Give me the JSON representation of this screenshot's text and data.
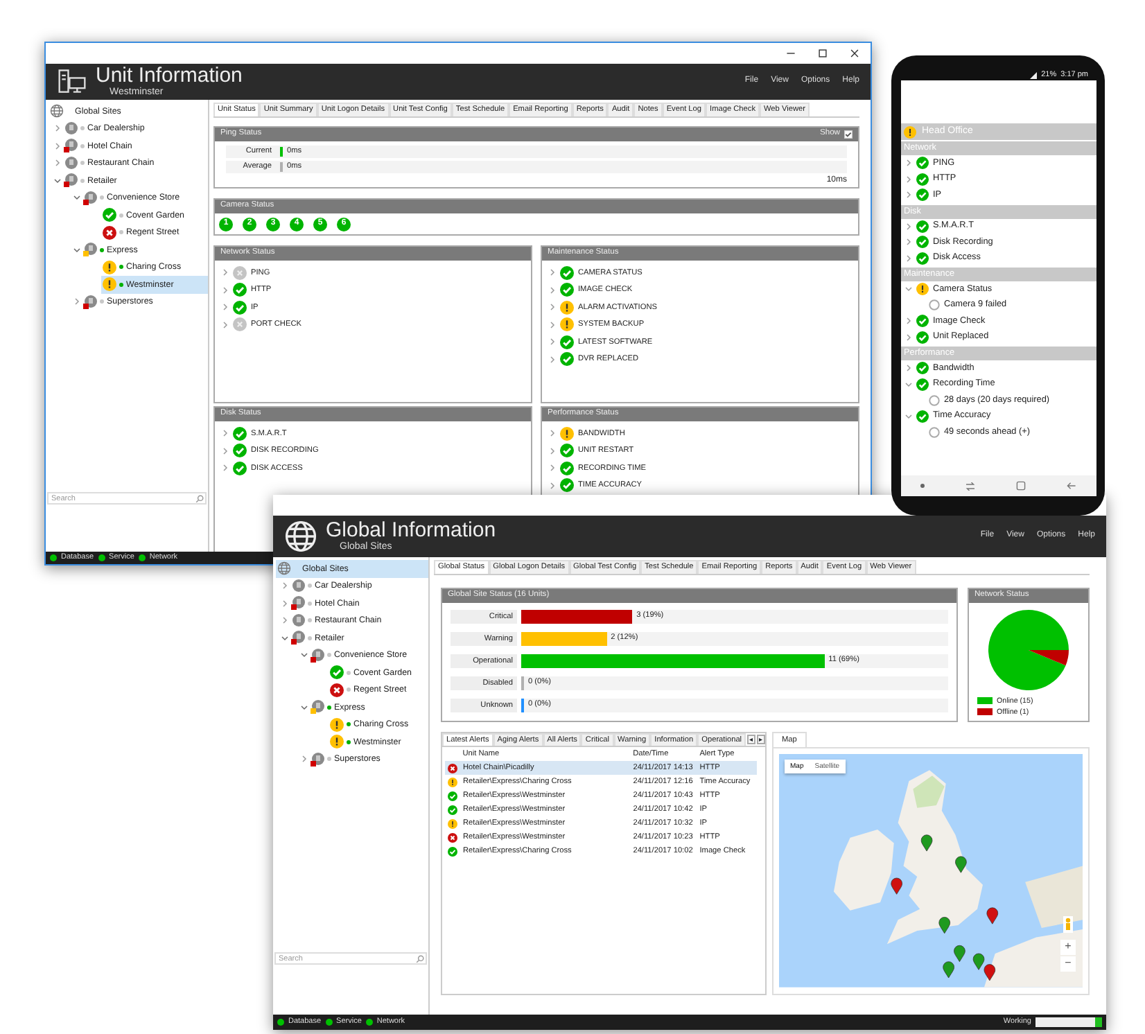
{
  "unit_window": {
    "title": "Unit Information",
    "subtitle": "Westminster",
    "menu": [
      "File",
      "View",
      "Options",
      "Help"
    ],
    "tree": {
      "root": {
        "label": "Global Sites",
        "selected": false
      },
      "items": [
        {
          "label": "Car Dealership",
          "kind": "group",
          "color": "#c8c8c8",
          "expanded": false,
          "selected": false
        },
        {
          "label": "Hotel Chain",
          "kind": "group",
          "flag": {
            "color": "#d00000"
          },
          "color": "#c8c8c8",
          "expanded": false,
          "selected": false
        },
        {
          "label": "Restaurant Chain",
          "kind": "group",
          "color": "#c8c8c8",
          "expanded": false,
          "selected": false
        },
        {
          "label": "Retailer",
          "kind": "group",
          "flag": {
            "color": "#d00000"
          },
          "color": "#c8c8c8",
          "expanded": true,
          "selected": false,
          "children": [
            {
              "label": "Convenience Store",
              "kind": "group",
              "flag": {
                "color": "#d00000"
              },
              "color": "#c8c8c8",
              "expanded": true,
              "selected": false,
              "children": [
                {
                  "label": "Covent Garden",
                  "kind": "ok",
                  "color": "#c8c8c8",
                  "selected": false
                },
                {
                  "label": "Regent Street",
                  "kind": "critical",
                  "color": "#c8c8c8",
                  "selected": false
                }
              ]
            },
            {
              "label": "Express",
              "kind": "group",
              "flag": {
                "color": "#ffc000"
              },
              "color": "#00b000",
              "expanded": true,
              "selected": false,
              "children": [
                {
                  "label": "Charing Cross",
                  "kind": "warning",
                  "color": "#00b000",
                  "selected": false
                },
                {
                  "label": "Westminster",
                  "kind": "warning",
                  "color": "#00b000",
                  "selected": true
                }
              ]
            },
            {
              "label": "Superstores",
              "kind": "group",
              "flag": {
                "color": "#d00000"
              },
              "color": "#c8c8c8",
              "expanded": false,
              "selected": false
            }
          ]
        }
      ]
    },
    "search": {
      "placeholder": "Search"
    },
    "tabs": [
      {
        "label": "Unit Status",
        "selected": true
      },
      {
        "label": "Unit Summary",
        "selected": false
      },
      {
        "label": "Unit Logon Details",
        "selected": false
      },
      {
        "label": "Unit Test Config",
        "selected": false
      },
      {
        "label": "Test Schedule",
        "selected": false
      },
      {
        "label": "Email Reporting",
        "selected": false
      },
      {
        "label": "Reports",
        "selected": false
      },
      {
        "label": "Audit",
        "selected": false
      },
      {
        "label": "Notes",
        "selected": false
      },
      {
        "label": "Event Log",
        "selected": false
      },
      {
        "label": "Image Check",
        "selected": false
      },
      {
        "label": "Web Viewer",
        "selected": false
      }
    ],
    "ping": {
      "title": "Ping Status",
      "show_label": "Show",
      "show_checked": true,
      "rows": [
        {
          "label": "Current",
          "value": "0ms",
          "level": 0.005,
          "color": "#00c000"
        },
        {
          "label": "Average",
          "value": "0ms",
          "level": 0.005,
          "color": "#b0b0b0"
        }
      ],
      "scale_max": "10ms"
    },
    "camera": {
      "title": "Camera Status",
      "cameras": [
        {
          "label": "1",
          "kind": "ok"
        },
        {
          "label": "2",
          "kind": "ok"
        },
        {
          "label": "3",
          "kind": "ok"
        },
        {
          "label": "4",
          "kind": "ok"
        },
        {
          "label": "5",
          "kind": "ok"
        },
        {
          "label": "6",
          "kind": "ok"
        }
      ]
    },
    "panels": [
      {
        "title": "Network Status",
        "items": [
          {
            "label": "PING",
            "kind": "disabled"
          },
          {
            "label": "HTTP",
            "kind": "ok"
          },
          {
            "label": "IP",
            "kind": "ok"
          },
          {
            "label": "PORT CHECK",
            "kind": "disabled"
          }
        ]
      },
      {
        "title": "Maintenance Status",
        "items": [
          {
            "label": "CAMERA STATUS",
            "kind": "ok"
          },
          {
            "label": "IMAGE CHECK",
            "kind": "ok"
          },
          {
            "label": "ALARM ACTIVATIONS",
            "kind": "warning"
          },
          {
            "label": "SYSTEM BACKUP",
            "kind": "warning"
          },
          {
            "label": "LATEST SOFTWARE",
            "kind": "ok"
          },
          {
            "label": "DVR REPLACED",
            "kind": "ok"
          }
        ]
      },
      {
        "title": "Disk Status",
        "items": [
          {
            "label": "S.M.A.R.T",
            "kind": "ok"
          },
          {
            "label": "DISK RECORDING",
            "kind": "ok"
          },
          {
            "label": "DISK ACCESS",
            "kind": "ok"
          }
        ]
      },
      {
        "title": "Performance Status",
        "items": [
          {
            "label": "BANDWIDTH",
            "kind": "warning"
          },
          {
            "label": "UNIT RESTART",
            "kind": "ok"
          },
          {
            "label": "RECORDING TIME",
            "kind": "ok"
          },
          {
            "label": "TIME ACCURACY",
            "kind": "ok"
          }
        ]
      }
    ],
    "status_bar": [
      {
        "label": "Database",
        "color": "#00c000"
      },
      {
        "label": "Service",
        "color": "#00c000"
      },
      {
        "label": "Network",
        "color": "#00c000"
      }
    ]
  },
  "phone": {
    "battery": "21%",
    "time": "3:17 pm",
    "site": {
      "label": "Head Office",
      "kind": "warning"
    },
    "sections": [
      {
        "title": "Network",
        "items": [
          {
            "label": "PING",
            "kind": "ok",
            "expanded": false
          },
          {
            "label": "HTTP",
            "kind": "ok",
            "expanded": false
          },
          {
            "label": "IP",
            "kind": "ok",
            "expanded": false
          }
        ]
      },
      {
        "title": "Disk",
        "items": [
          {
            "label": "S.M.A.R.T",
            "kind": "ok",
            "expanded": false
          },
          {
            "label": "Disk Recording",
            "kind": "ok",
            "expanded": false
          },
          {
            "label": "Disk Access",
            "kind": "ok",
            "expanded": false
          }
        ]
      },
      {
        "title": "Maintenance",
        "items": [
          {
            "label": "Camera Status",
            "kind": "warning",
            "expanded": true,
            "children": [
              {
                "label": "Camera 9 failed",
                "kind": "info"
              }
            ]
          },
          {
            "label": "Image Check",
            "kind": "ok",
            "expanded": false
          },
          {
            "label": "Unit Replaced",
            "kind": "ok",
            "expanded": false
          }
        ]
      },
      {
        "title": "Performance",
        "items": [
          {
            "label": "Bandwidth",
            "kind": "ok",
            "expanded": false
          },
          {
            "label": "Recording Time",
            "kind": "ok",
            "expanded": true,
            "children": [
              {
                "label": "28 days (20 days required)",
                "kind": "info"
              }
            ]
          },
          {
            "label": "Time Accuracy",
            "kind": "ok",
            "expanded": true,
            "children": [
              {
                "label": "49 seconds ahead (+)",
                "kind": "info"
              }
            ]
          }
        ]
      }
    ]
  },
  "global_window": {
    "title": "Global Information",
    "subtitle": "Global Sites",
    "menu": [
      "File",
      "View",
      "Options",
      "Help"
    ],
    "tree": {
      "root": {
        "label": "Global Sites",
        "selected": true
      },
      "items": [
        {
          "label": "Car Dealership",
          "kind": "group",
          "color": "#c8c8c8",
          "expanded": false,
          "selected": false
        },
        {
          "label": "Hotel Chain",
          "kind": "group",
          "flag": {
            "color": "#d00000"
          },
          "color": "#c8c8c8",
          "expanded": false,
          "selected": false
        },
        {
          "label": "Restaurant Chain",
          "kind": "group",
          "color": "#c8c8c8",
          "expanded": false,
          "selected": false
        },
        {
          "label": "Retailer",
          "kind": "group",
          "flag": {
            "color": "#d00000"
          },
          "color": "#c8c8c8",
          "expanded": true,
          "selected": false,
          "children": [
            {
              "label": "Convenience Store",
              "kind": "group",
              "flag": {
                "color": "#d00000"
              },
              "color": "#c8c8c8",
              "expanded": true,
              "selected": false,
              "children": [
                {
                  "label": "Covent Garden",
                  "kind": "ok",
                  "color": "#c8c8c8",
                  "selected": false
                },
                {
                  "label": "Regent Street",
                  "kind": "critical",
                  "color": "#c8c8c8",
                  "selected": false
                }
              ]
            },
            {
              "label": "Express",
              "kind": "group",
              "flag": {
                "color": "#ffc000"
              },
              "color": "#00b000",
              "expanded": true,
              "selected": false,
              "children": [
                {
                  "label": "Charing Cross",
                  "kind": "warning",
                  "color": "#00b000",
                  "selected": false
                },
                {
                  "label": "Westminster",
                  "kind": "warning",
                  "color": "#00b000",
                  "selected": false
                }
              ]
            },
            {
              "label": "Superstores",
              "kind": "group",
              "flag": {
                "color": "#d00000"
              },
              "color": "#c8c8c8",
              "expanded": false,
              "selected": false
            }
          ]
        }
      ]
    },
    "search": {
      "placeholder": "Search"
    },
    "tabs": [
      {
        "label": "Global Status",
        "selected": true
      },
      {
        "label": "Global Logon Details",
        "selected": false
      },
      {
        "label": "Global Test Config",
        "selected": false
      },
      {
        "label": "Test Schedule",
        "selected": false
      },
      {
        "label": "Email Reporting",
        "selected": false
      },
      {
        "label": "Reports",
        "selected": false
      },
      {
        "label": "Audit",
        "selected": false
      },
      {
        "label": "Event Log",
        "selected": false
      },
      {
        "label": "Web Viewer",
        "selected": false
      }
    ],
    "site_status": {
      "title": "Global Site Status (16 Units)",
      "rows": [
        {
          "label": "Critical",
          "value": "3 (19%)",
          "level": 0.26,
          "color": "#c00000"
        },
        {
          "label": "Warning",
          "value": "2 (12%)",
          "level": 0.2,
          "color": "#ffc000"
        },
        {
          "label": "Operational",
          "value": "11 (69%)",
          "level": 0.71,
          "color": "#00c000"
        },
        {
          "label": "Disabled",
          "value": "0 (0%)",
          "level": 0.005,
          "color": "#b0b0b0"
        },
        {
          "label": "Unknown",
          "value": "0 (0%)",
          "level": 0.005,
          "color": "#2090ff"
        }
      ]
    },
    "network_status": {
      "chart_data": {
        "type": "pie",
        "title": "Network Status",
        "categories": [
          "Online (15)",
          "Offline (1)"
        ],
        "values": [
          15,
          1
        ],
        "colors": [
          "#00c000",
          "#c00000"
        ],
        "legend": "bottom"
      }
    },
    "alerts": {
      "tabs": [
        {
          "label": "Latest Alerts",
          "selected": true
        },
        {
          "label": "Aging Alerts",
          "selected": false
        },
        {
          "label": "All Alerts",
          "selected": false
        },
        {
          "label": "Critical",
          "selected": false
        },
        {
          "label": "Warning",
          "selected": false
        },
        {
          "label": "Information",
          "selected": false
        },
        {
          "label": "Operational",
          "selected": false
        }
      ],
      "scroll_buttons": [
        "◂",
        "▸"
      ],
      "columns": [
        "Unit Name",
        "Date/Time",
        "Alert Type"
      ],
      "rows": [
        {
          "kind": "critical",
          "unit": "Hotel Chain\\Picadilly",
          "time": "24/11/2017 14:13",
          "type": "HTTP",
          "selected": true
        },
        {
          "kind": "warning",
          "unit": "Retailer\\Express\\Charing Cross",
          "time": "24/11/2017 12:16",
          "type": "Time Accuracy",
          "selected": false
        },
        {
          "kind": "ok",
          "unit": "Retailer\\Express\\Westminster",
          "time": "24/11/2017 10:43",
          "type": "HTTP",
          "selected": false
        },
        {
          "kind": "ok",
          "unit": "Retailer\\Express\\Westminster",
          "time": "24/11/2017 10:42",
          "type": "IP",
          "selected": false
        },
        {
          "kind": "warning",
          "unit": "Retailer\\Express\\Westminster",
          "time": "24/11/2017 10:32",
          "type": "IP",
          "selected": false
        },
        {
          "kind": "critical",
          "unit": "Retailer\\Express\\Westminster",
          "time": "24/11/2017 10:23",
          "type": "HTTP",
          "selected": false
        },
        {
          "kind": "ok",
          "unit": "Retailer\\Express\\Charing Cross",
          "time": "24/11/2017 10:02",
          "type": "Image Check",
          "selected": false
        }
      ]
    },
    "map": {
      "tab": "Map",
      "types": [
        {
          "label": "Map",
          "selected": true
        },
        {
          "label": "Satellite",
          "selected": false
        }
      ],
      "zoom": [
        "+",
        "−"
      ]
    },
    "status_bar": [
      {
        "label": "Database",
        "color": "#00c000"
      },
      {
        "label": "Service",
        "color": "#00c000"
      },
      {
        "label": "Network",
        "color": "#00c000"
      }
    ],
    "activity": {
      "label": "Working",
      "level": 0.1
    }
  }
}
